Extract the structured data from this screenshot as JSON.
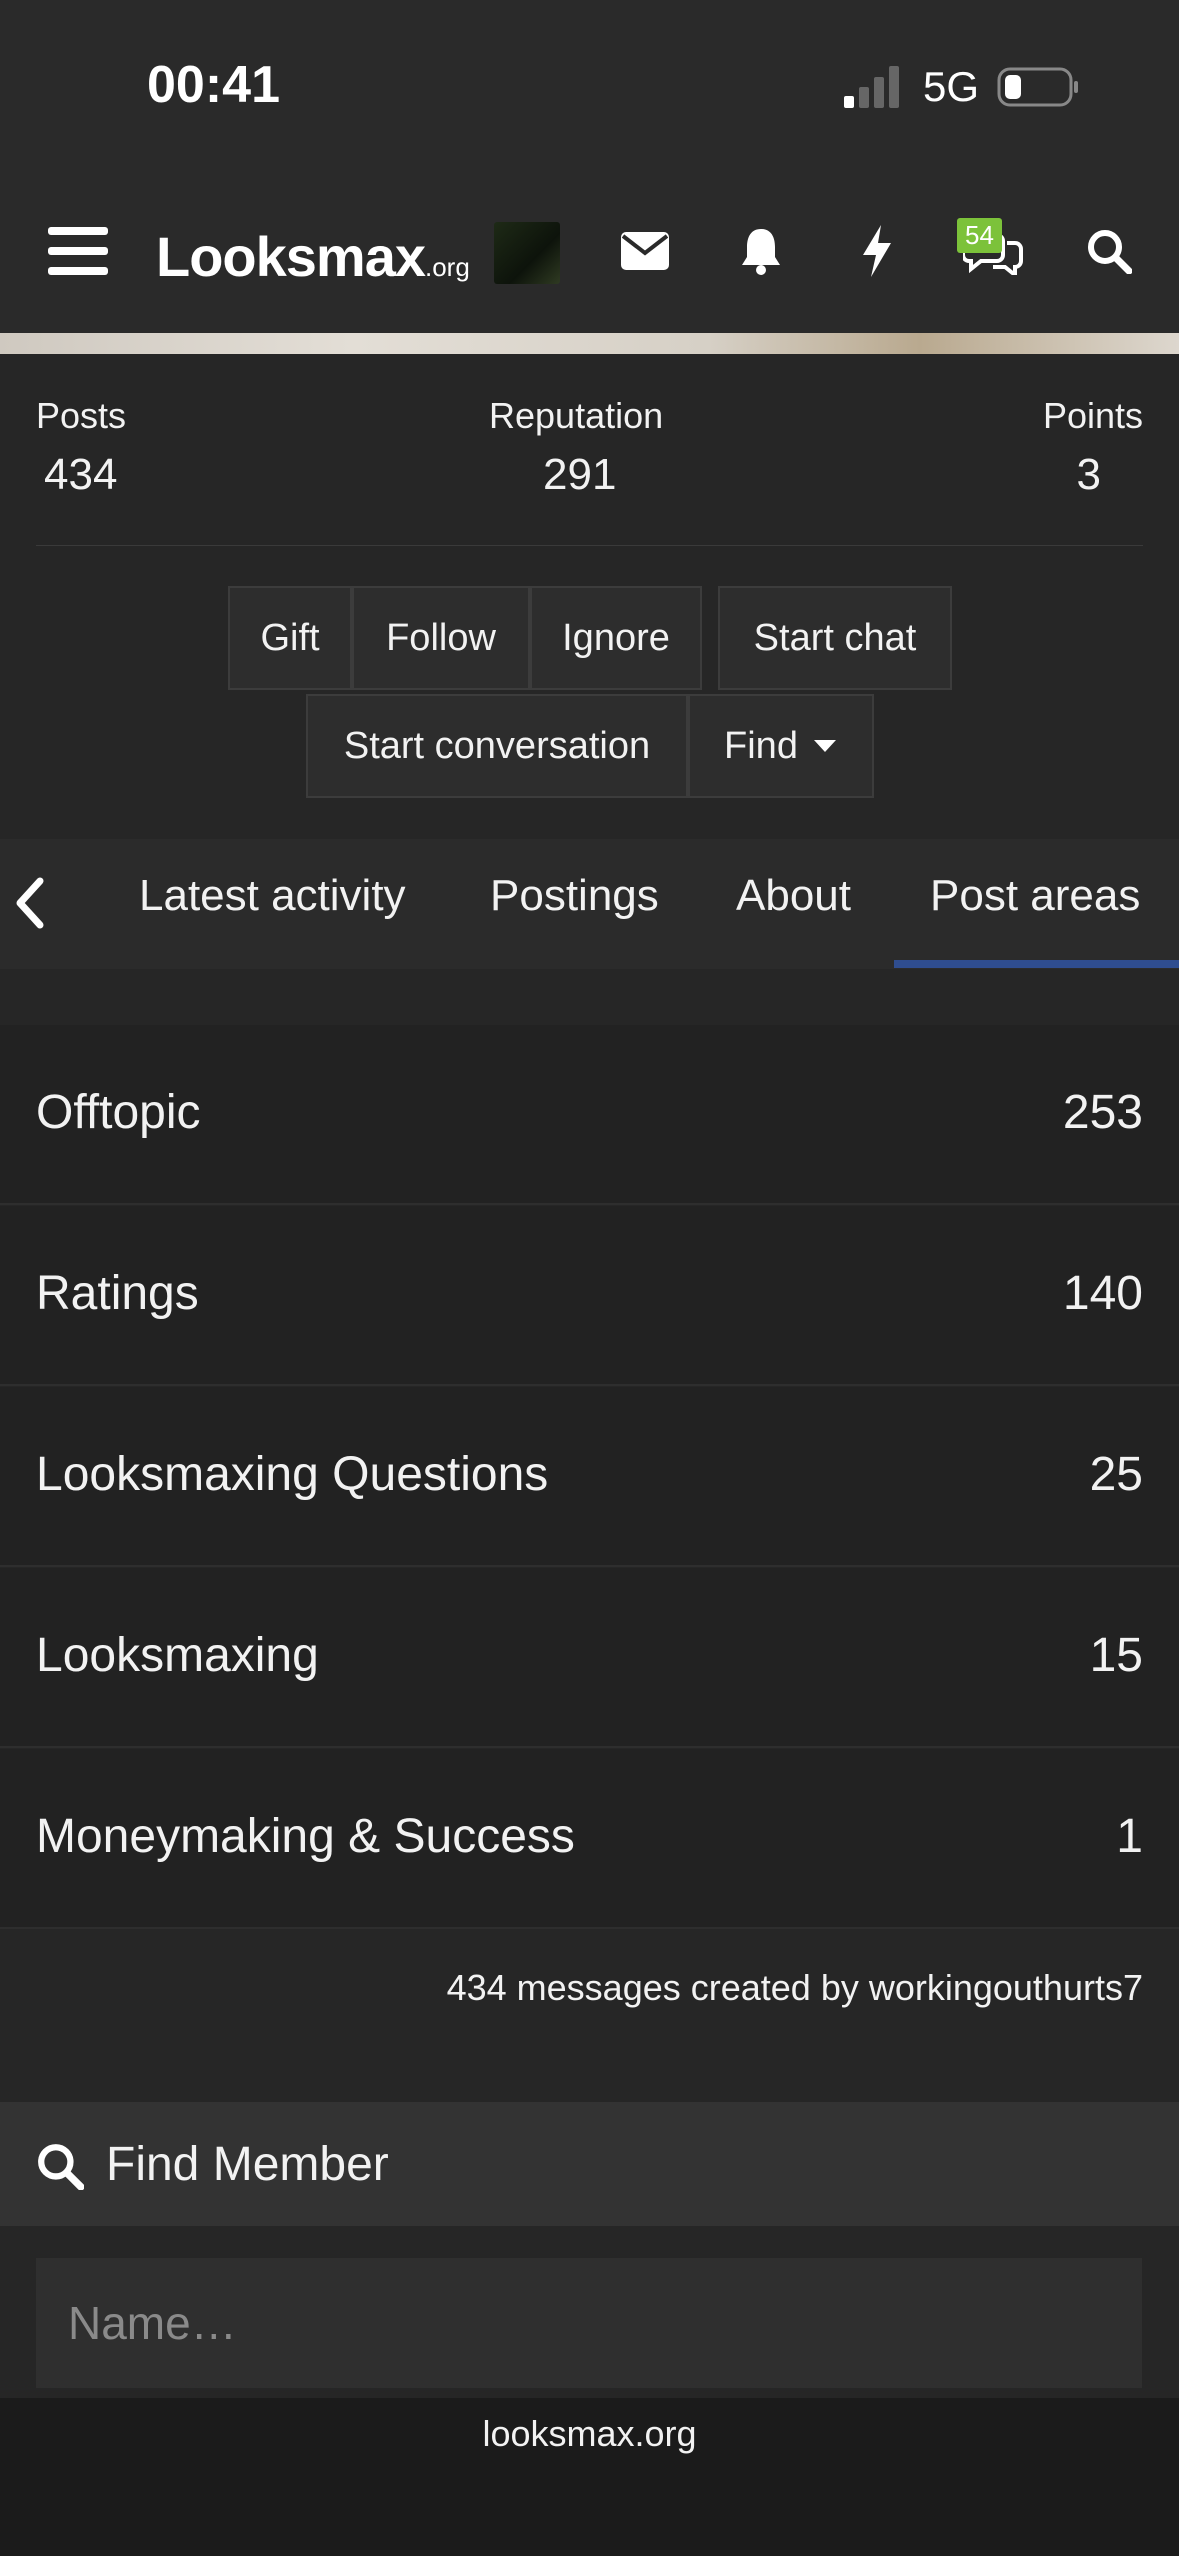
{
  "status_bar": {
    "time": "00:41",
    "network": "5G"
  },
  "nav": {
    "logo_main": "Looksmax",
    "logo_suffix": ".org",
    "conversations_badge": "54"
  },
  "stats": [
    {
      "label": "Posts",
      "value": "434"
    },
    {
      "label": "Reputation",
      "value": "291"
    },
    {
      "label": "Points",
      "value": "3"
    }
  ],
  "actions": {
    "gift": "Gift",
    "follow": "Follow",
    "ignore": "Ignore",
    "start_chat": "Start chat",
    "start_conversation": "Start conversation",
    "find": "Find"
  },
  "tabs": [
    "Latest activity",
    "Postings",
    "About",
    "Post areas"
  ],
  "active_tab": "Post areas",
  "post_areas": [
    {
      "name": "Offtopic",
      "count": "253"
    },
    {
      "name": "Ratings",
      "count": "140"
    },
    {
      "name": "Looksmaxing Questions",
      "count": "25"
    },
    {
      "name": "Looksmaxing",
      "count": "15"
    },
    {
      "name": "Moneymaking & Success",
      "count": "1"
    }
  ],
  "summary": "434 messages created by workingouthurts7",
  "find_member": {
    "title": "Find Member",
    "placeholder": "Name…"
  },
  "footer": {
    "site": "looksmax.org"
  },
  "colors": {
    "accent": "#2f4d8f",
    "badge": "#7cc23a",
    "background": "#262626"
  }
}
